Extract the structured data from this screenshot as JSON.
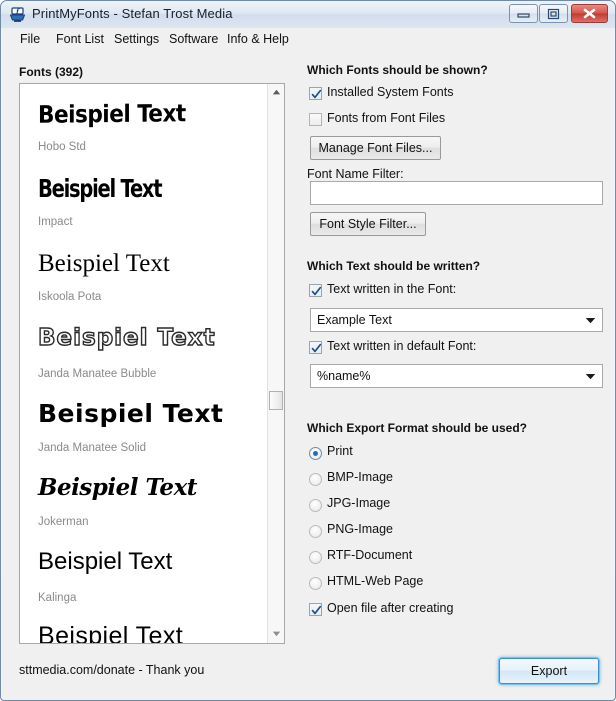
{
  "window": {
    "title": "PrintMyFonts - Stefan Trost Media",
    "app_icon": "printmyfonts-app-icon",
    "minimize_label": "Minimize",
    "maximize_label": "Maximize",
    "close_label": "Close"
  },
  "menubar": {
    "items": [
      {
        "label": "File"
      },
      {
        "label": "Font List"
      },
      {
        "label": "Settings"
      },
      {
        "label": "Software"
      },
      {
        "label": "Info & Help"
      }
    ]
  },
  "fonts_panel": {
    "header": "Fonts (392)",
    "count": 392,
    "items": [
      {
        "sample": "Beispiel Text",
        "name": "Hobo Std"
      },
      {
        "sample": "Beispiel Text",
        "name": "Impact"
      },
      {
        "sample": "Beispiel Text",
        "name": "Iskoola Pota"
      },
      {
        "sample": "Beispiel Text",
        "name": "Janda Manatee Bubble"
      },
      {
        "sample": "Beispiel Text",
        "name": "Janda Manatee Solid"
      },
      {
        "sample": "Beispiel Text",
        "name": "Jokerman"
      },
      {
        "sample": "Beispiel Text",
        "name": "Kalinga"
      },
      {
        "sample": "Beispiel  Text",
        "name": ""
      }
    ],
    "scroll_up_icon": "scroll-up-arrow-icon",
    "scroll_down_icon": "scroll-down-arrow-icon"
  },
  "fonts_group": {
    "heading": "Which Fonts should be shown?",
    "installed_system_fonts": {
      "label": "Installed System Fonts",
      "checked": true
    },
    "fonts_from_font_files": {
      "label": "Fonts from Font Files",
      "checked": false
    },
    "manage_button": "Manage Font Files...",
    "name_filter_label": "Font Name Filter:",
    "name_filter_value": "",
    "name_filter_placeholder": "",
    "style_filter_button": "Font Style Filter..."
  },
  "text_group": {
    "heading": "Which Text should be written?",
    "text_in_font": {
      "label": "Text written in the Font:",
      "checked": true
    },
    "text_in_font_value": "Example Text",
    "text_in_default_font": {
      "label": "Text written in default Font:",
      "checked": true
    },
    "text_in_default_font_value": "%name%",
    "dropdown_icon": "chevron-down-icon"
  },
  "export_group": {
    "heading": "Which Export Format should be used?",
    "options": [
      {
        "label": "Print",
        "selected": true
      },
      {
        "label": "BMP-Image",
        "selected": false
      },
      {
        "label": "JPG-Image",
        "selected": false
      },
      {
        "label": "PNG-Image",
        "selected": false
      },
      {
        "label": "RTF-Document",
        "selected": false
      },
      {
        "label": "HTML-Web Page",
        "selected": false
      }
    ],
    "open_file_after_creating": {
      "label": "Open file after creating",
      "checked": true
    }
  },
  "footer": {
    "status": "sttmedia.com/donate - Thank you",
    "export_button": "Export"
  },
  "colors": {
    "accent": "#1c6fb8",
    "window_frame": "#6f8aa5",
    "client_bg": "#f0f0f0",
    "font_name_grey": "#8a8a8a",
    "close_button_red": "#c03a31"
  }
}
